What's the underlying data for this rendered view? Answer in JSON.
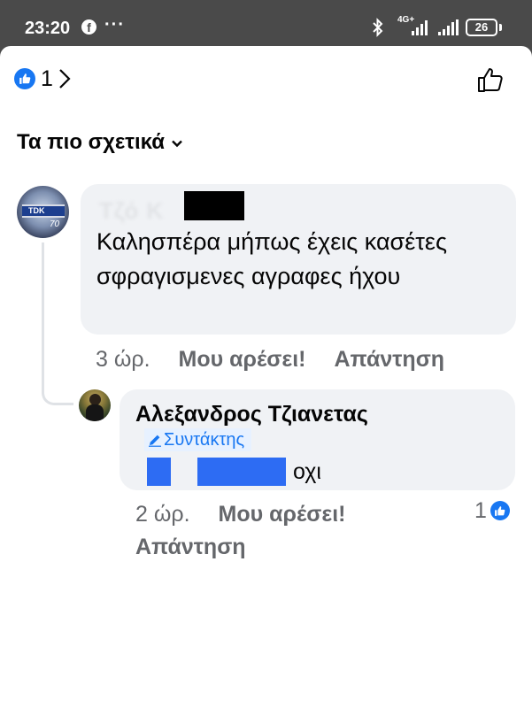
{
  "status_bar": {
    "time": "23:20",
    "notification_icon": "facebook-icon",
    "more_indicator": "···",
    "network_label": "4G+",
    "battery_level": "26",
    "bluetooth_icon": "bluetooth-icon"
  },
  "header": {
    "reaction_count": "1",
    "reaction_icon": "like-icon",
    "like_button_icon": "thumbs-up-outline-icon"
  },
  "sort": {
    "label": "Τα πιο σχετικά",
    "icon": "chevron-down-icon"
  },
  "comments": [
    {
      "author_blurred": "Τζό Κ",
      "text": "Καλησπέρα μήπως έχεις κασέτες σφραγισμενες αγραφες ήχου",
      "time": "3 ώρ.",
      "like_label": "Μου αρέσει!",
      "reply_label": "Απάντηση",
      "avatar_text": "TDK",
      "avatar_number": "70"
    },
    {
      "author": "Αλεξανδρος Τζιανετας",
      "role": "Συντάκτης",
      "role_icon": "pencil-icon",
      "text": "οχι",
      "time": "2 ώρ.",
      "like_label": "Μου αρέσει!",
      "reply_label": "Απάντηση",
      "reaction_count": "1"
    }
  ],
  "colors": {
    "brand_blue": "#1877f2",
    "bubble_bg": "#f0f2f5",
    "meta_text": "#65676b",
    "status_bar_bg": "#4a4a4a",
    "redaction_blue": "#2d6cf3"
  }
}
